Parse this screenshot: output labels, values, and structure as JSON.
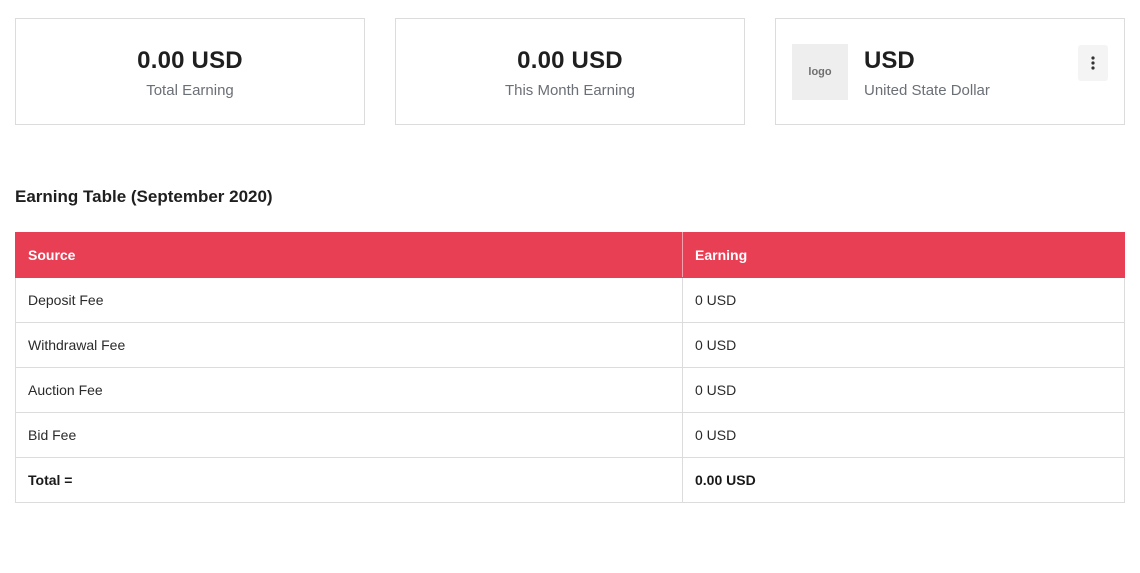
{
  "cards": {
    "total_earning": {
      "amount": "0.00 USD",
      "caption": "Total Earning"
    },
    "month_earning": {
      "amount": "0.00 USD",
      "caption": "This Month Earning"
    },
    "currency": {
      "logo_text": "logo",
      "code": "USD",
      "name": "United State Dollar",
      "menu_icon": "vertical-dots-icon"
    }
  },
  "table": {
    "title": "Earning Table (September 2020)",
    "headers": [
      "Source",
      "Earning"
    ],
    "rows": [
      {
        "source": "Deposit Fee",
        "earning": "0 USD"
      },
      {
        "source": "Withdrawal Fee",
        "earning": "0 USD"
      },
      {
        "source": "Auction Fee",
        "earning": "0 USD"
      },
      {
        "source": "Bid Fee",
        "earning": "0 USD"
      }
    ],
    "total": {
      "label": "Total =",
      "value": "0.00 USD"
    }
  },
  "colors": {
    "header_bg": "#e83f55",
    "header_text": "#ffffff",
    "border": "#dcdcdc",
    "muted_text": "#6b6f76"
  }
}
